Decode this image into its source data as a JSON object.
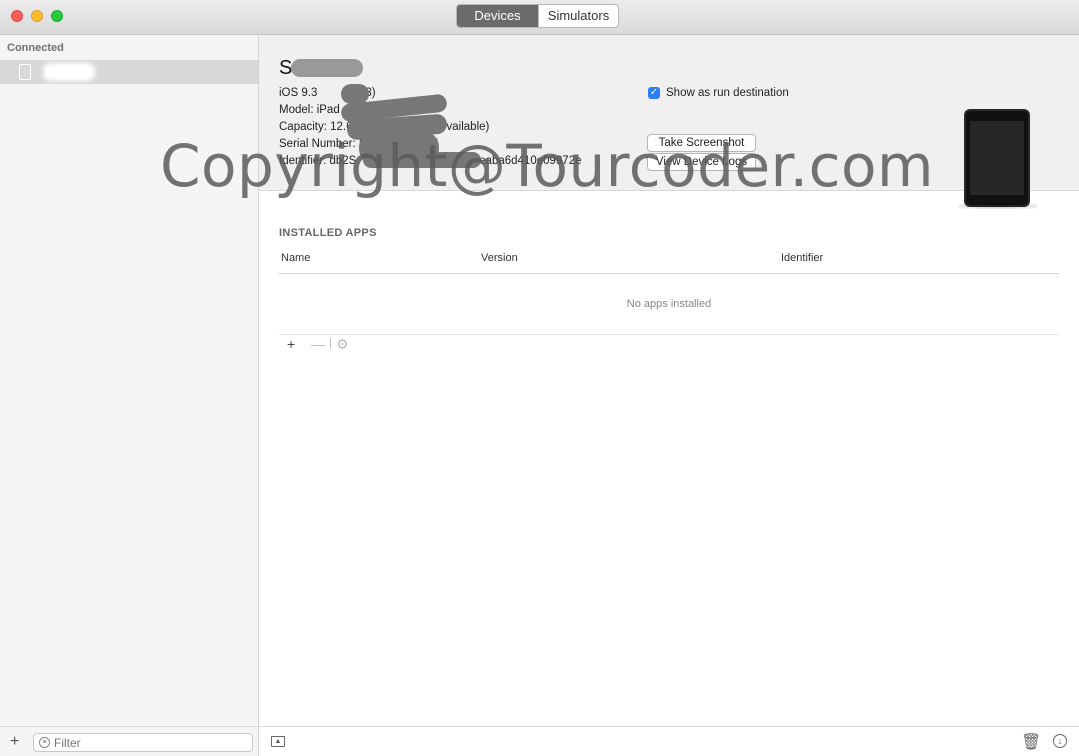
{
  "window": {
    "tabs": [
      {
        "label": "Devices",
        "active": true
      },
      {
        "label": "Simulators",
        "active": false
      }
    ]
  },
  "sidebar": {
    "section_heading": "Connected",
    "filter_placeholder": "Filter",
    "add_label": "+"
  },
  "device": {
    "name": "S",
    "ios_label": "iOS 9.3",
    "ios_suffix": "3)",
    "model_label": "Model: iPad",
    "capacity_label": "Capacity: 12.6",
    "capacity_suffix": "vailable)",
    "serial_label": "Serial Number: F",
    "serial_suffix": "34",
    "identifier_label": "Identifier: db2S",
    "identifier_suffix": "3beaba6d410e09972e",
    "show_run_destination": "Show as run destination",
    "show_run_checked": true,
    "take_screenshot": "Take Screenshot",
    "view_logs": "View Device Logs"
  },
  "watermark": "Copyright@Tourcoder.com",
  "installed_apps": {
    "title": "INSTALLED APPS",
    "columns": [
      "Name",
      "Version",
      "Identifier"
    ],
    "empty_message": "No apps installed",
    "toolbar": {
      "add": "+",
      "remove": "—",
      "settings": "⚙"
    }
  },
  "colors": {
    "accent": "#2b7ef5",
    "segment_active": "#6b6b6b",
    "sidebar_selection": "#d8d8d8"
  }
}
